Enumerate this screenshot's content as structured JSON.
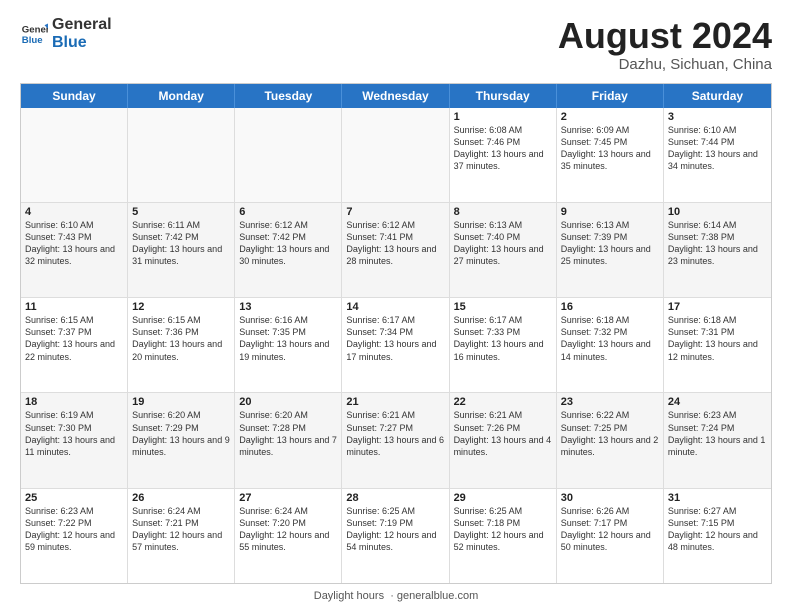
{
  "logo": {
    "line1": "General",
    "line2": "Blue"
  },
  "title": "August 2024",
  "subtitle": "Dazhu, Sichuan, China",
  "days_of_week": [
    "Sunday",
    "Monday",
    "Tuesday",
    "Wednesday",
    "Thursday",
    "Friday",
    "Saturday"
  ],
  "footer_text": "Daylight hours",
  "footer_url": "https://www.generalblue.com",
  "weeks": [
    [
      {
        "day": "",
        "empty": true,
        "text": ""
      },
      {
        "day": "",
        "empty": true,
        "text": ""
      },
      {
        "day": "",
        "empty": true,
        "text": ""
      },
      {
        "day": "",
        "empty": true,
        "text": ""
      },
      {
        "day": "1",
        "empty": false,
        "text": "Sunrise: 6:08 AM\nSunset: 7:46 PM\nDaylight: 13 hours and 37 minutes."
      },
      {
        "day": "2",
        "empty": false,
        "text": "Sunrise: 6:09 AM\nSunset: 7:45 PM\nDaylight: 13 hours and 35 minutes."
      },
      {
        "day": "3",
        "empty": false,
        "text": "Sunrise: 6:10 AM\nSunset: 7:44 PM\nDaylight: 13 hours and 34 minutes."
      }
    ],
    [
      {
        "day": "4",
        "empty": false,
        "text": "Sunrise: 6:10 AM\nSunset: 7:43 PM\nDaylight: 13 hours and 32 minutes."
      },
      {
        "day": "5",
        "empty": false,
        "text": "Sunrise: 6:11 AM\nSunset: 7:42 PM\nDaylight: 13 hours and 31 minutes."
      },
      {
        "day": "6",
        "empty": false,
        "text": "Sunrise: 6:12 AM\nSunset: 7:42 PM\nDaylight: 13 hours and 30 minutes."
      },
      {
        "day": "7",
        "empty": false,
        "text": "Sunrise: 6:12 AM\nSunset: 7:41 PM\nDaylight: 13 hours and 28 minutes."
      },
      {
        "day": "8",
        "empty": false,
        "text": "Sunrise: 6:13 AM\nSunset: 7:40 PM\nDaylight: 13 hours and 27 minutes."
      },
      {
        "day": "9",
        "empty": false,
        "text": "Sunrise: 6:13 AM\nSunset: 7:39 PM\nDaylight: 13 hours and 25 minutes."
      },
      {
        "day": "10",
        "empty": false,
        "text": "Sunrise: 6:14 AM\nSunset: 7:38 PM\nDaylight: 13 hours and 23 minutes."
      }
    ],
    [
      {
        "day": "11",
        "empty": false,
        "text": "Sunrise: 6:15 AM\nSunset: 7:37 PM\nDaylight: 13 hours and 22 minutes."
      },
      {
        "day": "12",
        "empty": false,
        "text": "Sunrise: 6:15 AM\nSunset: 7:36 PM\nDaylight: 13 hours and 20 minutes."
      },
      {
        "day": "13",
        "empty": false,
        "text": "Sunrise: 6:16 AM\nSunset: 7:35 PM\nDaylight: 13 hours and 19 minutes."
      },
      {
        "day": "14",
        "empty": false,
        "text": "Sunrise: 6:17 AM\nSunset: 7:34 PM\nDaylight: 13 hours and 17 minutes."
      },
      {
        "day": "15",
        "empty": false,
        "text": "Sunrise: 6:17 AM\nSunset: 7:33 PM\nDaylight: 13 hours and 16 minutes."
      },
      {
        "day": "16",
        "empty": false,
        "text": "Sunrise: 6:18 AM\nSunset: 7:32 PM\nDaylight: 13 hours and 14 minutes."
      },
      {
        "day": "17",
        "empty": false,
        "text": "Sunrise: 6:18 AM\nSunset: 7:31 PM\nDaylight: 13 hours and 12 minutes."
      }
    ],
    [
      {
        "day": "18",
        "empty": false,
        "text": "Sunrise: 6:19 AM\nSunset: 7:30 PM\nDaylight: 13 hours and 11 minutes."
      },
      {
        "day": "19",
        "empty": false,
        "text": "Sunrise: 6:20 AM\nSunset: 7:29 PM\nDaylight: 13 hours and 9 minutes."
      },
      {
        "day": "20",
        "empty": false,
        "text": "Sunrise: 6:20 AM\nSunset: 7:28 PM\nDaylight: 13 hours and 7 minutes."
      },
      {
        "day": "21",
        "empty": false,
        "text": "Sunrise: 6:21 AM\nSunset: 7:27 PM\nDaylight: 13 hours and 6 minutes."
      },
      {
        "day": "22",
        "empty": false,
        "text": "Sunrise: 6:21 AM\nSunset: 7:26 PM\nDaylight: 13 hours and 4 minutes."
      },
      {
        "day": "23",
        "empty": false,
        "text": "Sunrise: 6:22 AM\nSunset: 7:25 PM\nDaylight: 13 hours and 2 minutes."
      },
      {
        "day": "24",
        "empty": false,
        "text": "Sunrise: 6:23 AM\nSunset: 7:24 PM\nDaylight: 13 hours and 1 minute."
      }
    ],
    [
      {
        "day": "25",
        "empty": false,
        "text": "Sunrise: 6:23 AM\nSunset: 7:22 PM\nDaylight: 12 hours and 59 minutes."
      },
      {
        "day": "26",
        "empty": false,
        "text": "Sunrise: 6:24 AM\nSunset: 7:21 PM\nDaylight: 12 hours and 57 minutes."
      },
      {
        "day": "27",
        "empty": false,
        "text": "Sunrise: 6:24 AM\nSunset: 7:20 PM\nDaylight: 12 hours and 55 minutes."
      },
      {
        "day": "28",
        "empty": false,
        "text": "Sunrise: 6:25 AM\nSunset: 7:19 PM\nDaylight: 12 hours and 54 minutes."
      },
      {
        "day": "29",
        "empty": false,
        "text": "Sunrise: 6:25 AM\nSunset: 7:18 PM\nDaylight: 12 hours and 52 minutes."
      },
      {
        "day": "30",
        "empty": false,
        "text": "Sunrise: 6:26 AM\nSunset: 7:17 PM\nDaylight: 12 hours and 50 minutes."
      },
      {
        "day": "31",
        "empty": false,
        "text": "Sunrise: 6:27 AM\nSunset: 7:15 PM\nDaylight: 12 hours and 48 minutes."
      }
    ]
  ]
}
